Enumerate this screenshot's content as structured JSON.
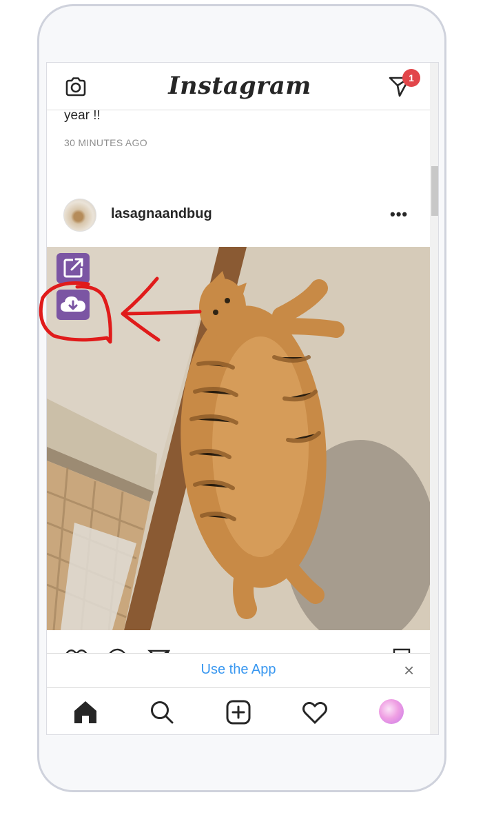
{
  "header": {
    "logo_text": "Instagram",
    "direct_badge_count": "1"
  },
  "feed": {
    "previous_caption_tail": "year !!",
    "previous_post_time": "30 MINUTES AGO",
    "post": {
      "username": "lasagnaandbug",
      "more_label": "•••"
    }
  },
  "extension": {
    "open_icon": "open-external-icon",
    "download_icon": "cloud-download-icon",
    "button_color": "#7b55a3"
  },
  "use_app_banner": {
    "label": "Use the App",
    "close_label": "×",
    "link_color": "#3897f0"
  },
  "bottom_nav": {
    "items": [
      "home-icon",
      "search-icon",
      "new-post-icon",
      "activity-heart-icon",
      "profile-avatar"
    ]
  },
  "annotation": {
    "color": "#e01b1b",
    "shapes": [
      "circle-around-download-button",
      "arrow-pointing-left"
    ]
  }
}
